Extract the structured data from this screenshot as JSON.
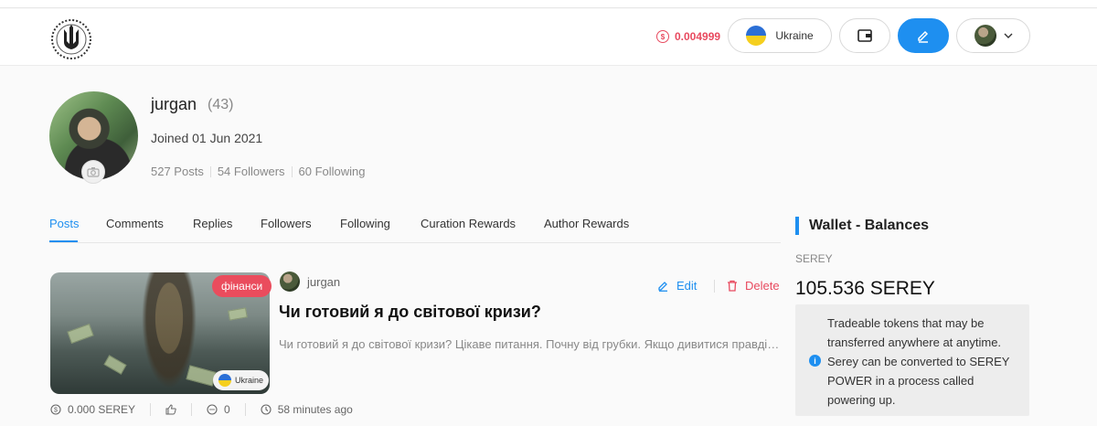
{
  "header": {
    "price": "0.004999",
    "language": "Ukraine",
    "colors": {
      "accent": "#1e8ff0",
      "danger": "#e84a5f"
    }
  },
  "profile": {
    "username": "jurgan",
    "reputation": "(43)",
    "joined": "Joined 01 Jun 2021",
    "posts": "527 Posts",
    "followers": "54 Followers",
    "following": "60 Following"
  },
  "tabs": [
    "Posts",
    "Comments",
    "Replies",
    "Followers",
    "Following",
    "Curation Rewards",
    "Author Rewards"
  ],
  "post": {
    "category": "фінанси",
    "language": "Ukraine",
    "author": "jurgan",
    "edit_label": "Edit",
    "delete_label": "Delete",
    "title": "Чи готовий я до світової кризи?",
    "excerpt": "Чи готовий я до світової кризи? Цікаве питання. Почну від грубки. Якщо дивитися правді в очі…",
    "payout": "0.000 SEREY",
    "comments": "0",
    "time": "58 minutes ago"
  },
  "wallet": {
    "title": "Wallet - Balances",
    "label": "SEREY",
    "amount": "105.536 SEREY",
    "info": "Tradeable tokens that may be transferred anywhere at anytime. Serey can be converted to SEREY POWER in a process called powering up."
  }
}
